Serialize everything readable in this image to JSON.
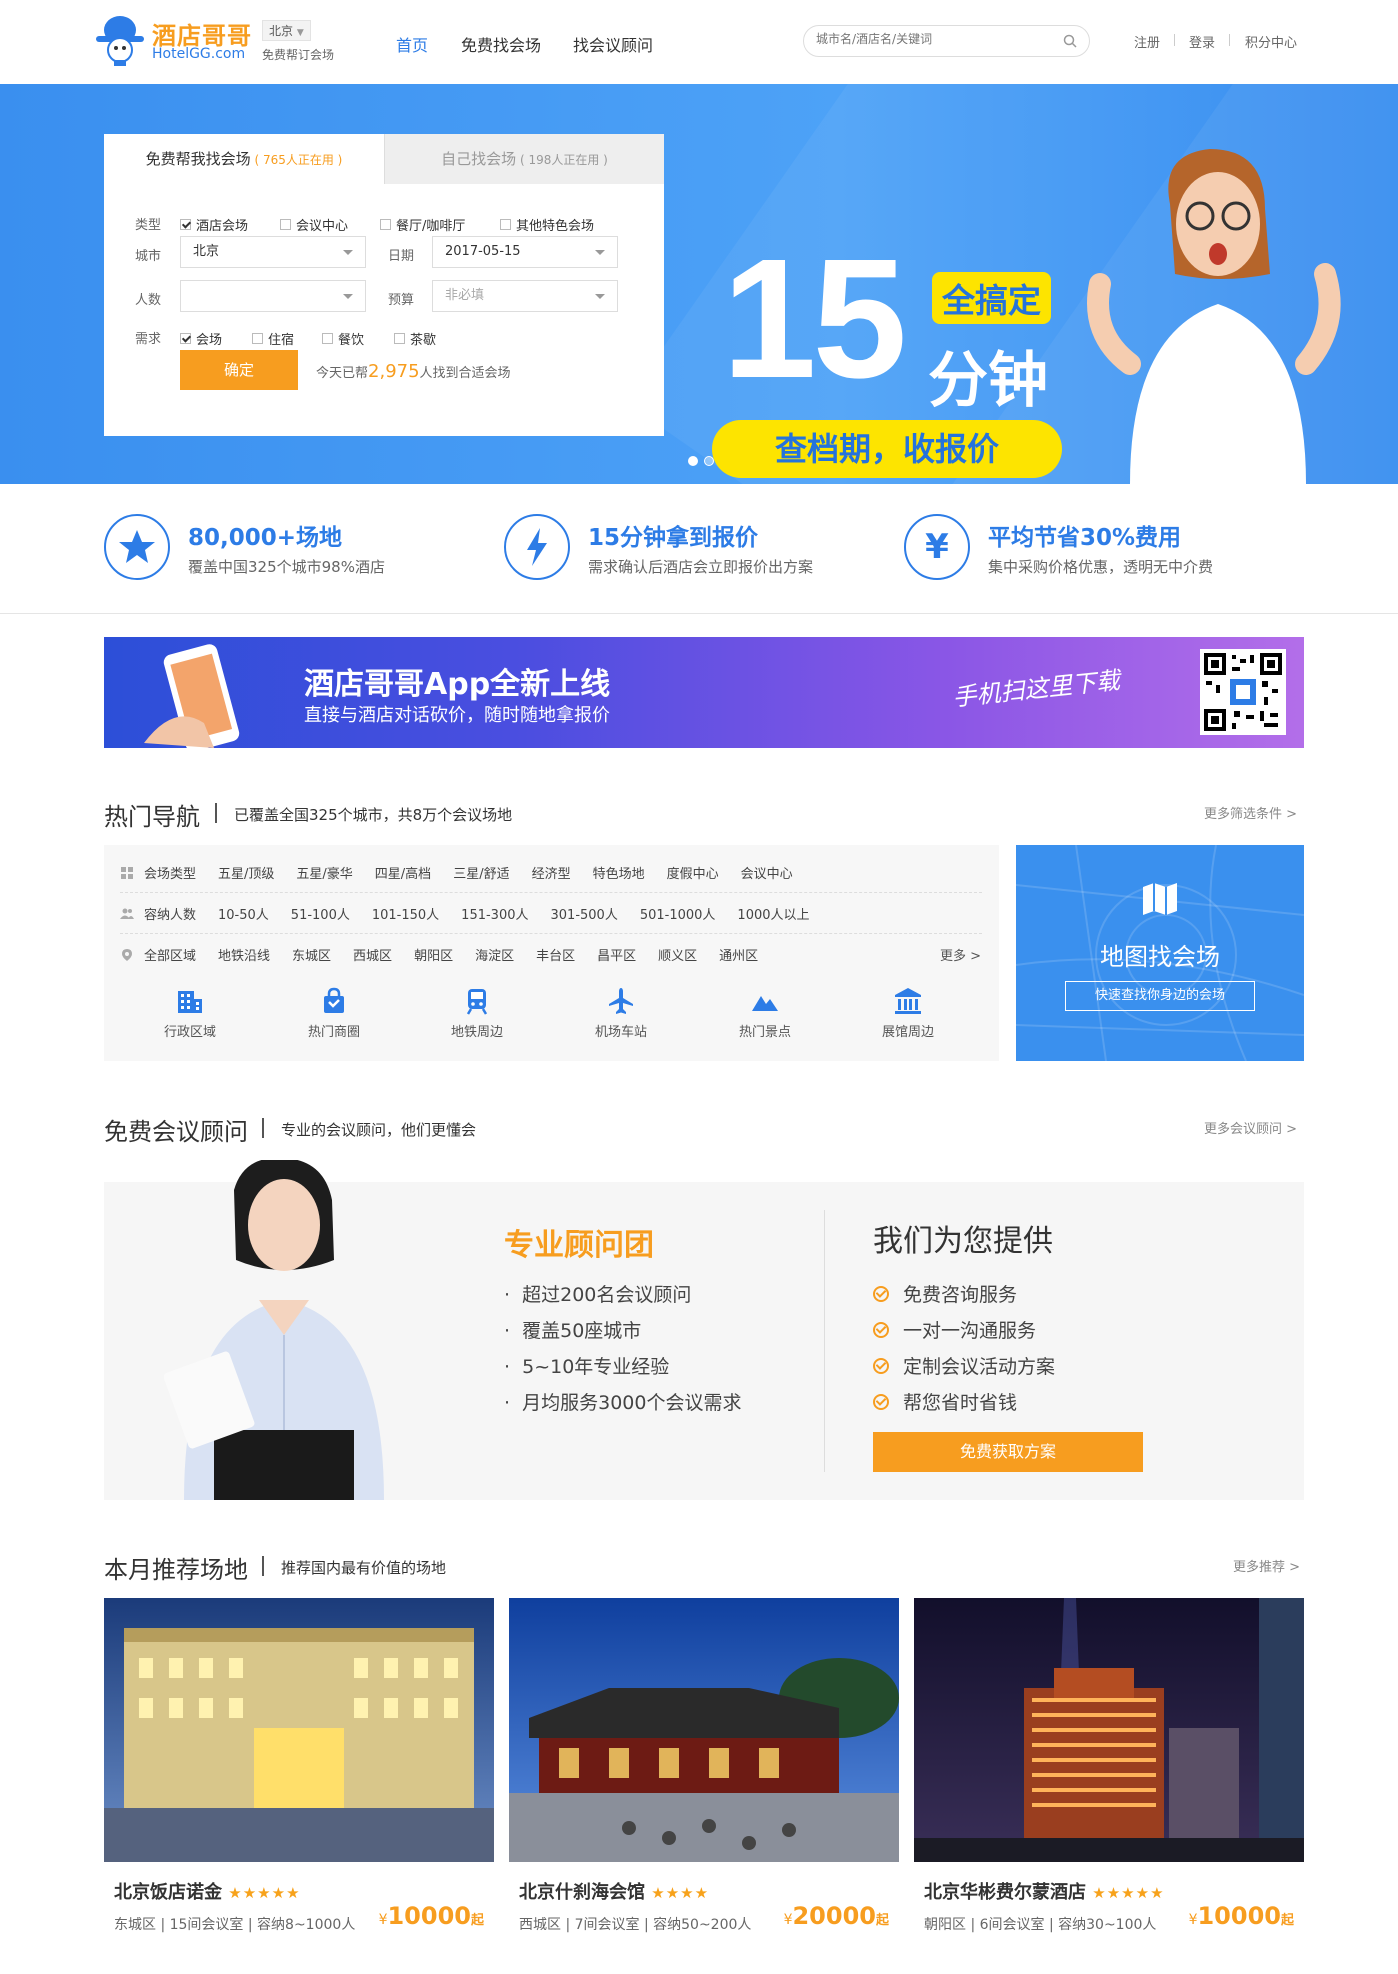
{
  "header": {
    "logo_cn": "酒店哥哥",
    "logo_en": "HotelGG.com",
    "city": "北京",
    "city_tag": "免费帮订会场",
    "nav": [
      "首页",
      "免费找会场",
      "找会议顾问"
    ],
    "search_placeholder": "城市名/酒店名/关键词",
    "links": [
      "注册",
      "登录",
      "积分中心"
    ]
  },
  "search_box": {
    "tab1_label": "免费帮我找会场",
    "tab1_count": "765人正在用",
    "tab2_label": "自己找会场",
    "tab2_count": "198人正在用",
    "type_label": "类型",
    "types": [
      "酒店会场",
      "会议中心",
      "餐厅/咖啡厅",
      "其他特色会场"
    ],
    "city_label": "城市",
    "city_value": "北京",
    "date_label": "日期",
    "date_value": "2017-05-15",
    "people_label": "人数",
    "budget_label": "预算",
    "budget_placeholder": "非必填",
    "need_label": "需求",
    "needs": [
      "会场",
      "住宿",
      "餐饮",
      "茶歇"
    ],
    "submit": "确定",
    "stat_prefix": "今天已帮",
    "stat_number": "2,975",
    "stat_suffix": "人找到合适会场"
  },
  "banner": {
    "big_number": "15",
    "badge": "全搞定",
    "unit": "分钟",
    "slogan": "查档期，收报价"
  },
  "features": [
    {
      "icon": "star-icon",
      "title": "80,000+场地",
      "desc": "覆盖中国325个城市98%酒店"
    },
    {
      "icon": "lightning-icon",
      "title": "15分钟拿到报价",
      "desc": "需求确认后酒店会立即报价出方案"
    },
    {
      "icon": "yen-icon",
      "title": "平均节省30%费用",
      "desc": "集中采购价格优惠，透明无中介费"
    }
  ],
  "app_banner": {
    "title": "酒店哥哥App全新上线",
    "subtitle": "直接与酒店对话砍价，随时随地拿报价",
    "hint": "手机扫这里下载"
  },
  "hot_nav": {
    "title": "热门导航",
    "desc": "已覆盖全国325个城市，共8万个会议场地",
    "more": "更多筛选条件 >",
    "row1": {
      "label": "会场类型",
      "items": [
        "五星/顶级",
        "五星/豪华",
        "四星/高档",
        "三星/舒适",
        "经济型",
        "特色场地",
        "度假中心",
        "会议中心"
      ]
    },
    "row2": {
      "label": "容纳人数",
      "items": [
        "10-50人",
        "51-100人",
        "101-150人",
        "151-300人",
        "301-500人",
        "501-1000人",
        "1000人以上"
      ]
    },
    "row3": {
      "label": "全部区域",
      "items": [
        "地铁沿线",
        "东城区",
        "西城区",
        "朝阳区",
        "海淀区",
        "丰台区",
        "昌平区",
        "顺义区",
        "通州区"
      ],
      "more": "更多 >"
    },
    "categories": [
      {
        "icon": "building-icon",
        "label": "行政区域"
      },
      {
        "icon": "shopping-bag-icon",
        "label": "热门商圈"
      },
      {
        "icon": "subway-icon",
        "label": "地铁周边"
      },
      {
        "icon": "airplane-icon",
        "label": "机场车站"
      },
      {
        "icon": "mountain-icon",
        "label": "热门景点"
      },
      {
        "icon": "museum-icon",
        "label": "展馆周边"
      }
    ],
    "map_title": "地图找会场",
    "map_button": "快速查找你身边的会场"
  },
  "consultant": {
    "title": "免费会议顾问",
    "desc": "专业的会议顾问，他们更懂会",
    "more": "更多会议顾问 >",
    "team_title": "专业顾问团",
    "team_points": [
      "超过200名会议顾问",
      "覆盖50座城市",
      "5~10年专业经验",
      "月均服务3000个会议需求"
    ],
    "provide_title": "我们为您提供",
    "provide_points": [
      "免费咨询服务",
      "一对一沟通服务",
      "定制会议活动方案",
      "帮您省时省钱"
    ],
    "button": "免费获取方案"
  },
  "recommend": {
    "title": "本月推荐场地",
    "desc": "推荐国内最有价值的场地",
    "more": "更多推荐 >",
    "venues": [
      {
        "name": "北京饭店诺金",
        "stars": "★★★★★",
        "info": "东城区 | 15间会议室 | 容纳8~1000人",
        "price": "10000",
        "currency": "¥",
        "unit": "起"
      },
      {
        "name": "北京什刹海会馆",
        "stars": "★★★★",
        "info": "西城区 | 7间会议室 | 容纳50~200人",
        "price": "20000",
        "currency": "¥",
        "unit": "起"
      },
      {
        "name": "北京华彬费尔蒙酒店",
        "stars": "★★★★★",
        "info": "朝阳区 | 6间会议室 | 容纳30~100人",
        "price": "10000",
        "currency": "¥",
        "unit": "起"
      }
    ]
  },
  "colors": {
    "brand_blue": "#2d7ce6",
    "brand_orange": "#f79d1f",
    "banner_yellow": "#fde400"
  }
}
